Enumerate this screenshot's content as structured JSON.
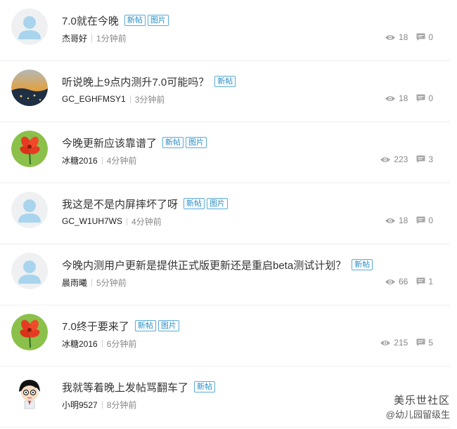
{
  "posts": [
    {
      "title": "7.0就在今晚",
      "tags": [
        "新帖",
        "图片"
      ],
      "author": "杰哥好",
      "time": "1分钟前",
      "views": "18",
      "replies": "0",
      "avatar": "default"
    },
    {
      "title": "听说晚上9点内测升7.0可能吗？",
      "tags": [
        "新帖"
      ],
      "author": "GC_EGHFMSY1",
      "time": "3分钟前",
      "views": "18",
      "replies": "0",
      "avatar": "scenery"
    },
    {
      "title": "今晚更新应该靠谱了",
      "tags": [
        "新帖",
        "图片"
      ],
      "author": "冰糖2016",
      "time": "4分钟前",
      "views": "223",
      "replies": "3",
      "avatar": "flower"
    },
    {
      "title": "我这是不是内屏摔坏了呀",
      "tags": [
        "新帖",
        "图片"
      ],
      "author": "GC_W1UH7WS",
      "time": "4分钟前",
      "views": "18",
      "replies": "0",
      "avatar": "default"
    },
    {
      "title": "今晚内测用户更新是提供正式版更新还是重启beta测试计划？",
      "tags": [
        "新帖"
      ],
      "author": "晨雨曦",
      "time": "5分钟前",
      "views": "66",
      "replies": "1",
      "avatar": "default"
    },
    {
      "title": "7.0终于要来了",
      "tags": [
        "新帖",
        "图片"
      ],
      "author": "冰糖2016",
      "time": "6分钟前",
      "views": "215",
      "replies": "5",
      "avatar": "flower"
    },
    {
      "title": "我就等着晚上发帖骂翻车了",
      "tags": [
        "新帖"
      ],
      "author": "小明9527",
      "time": "8分钟前",
      "views": "",
      "replies": "",
      "avatar": "cartoon"
    }
  ],
  "watermark": {
    "brand": "美乐世社区",
    "user": "@幼儿园留级生"
  }
}
